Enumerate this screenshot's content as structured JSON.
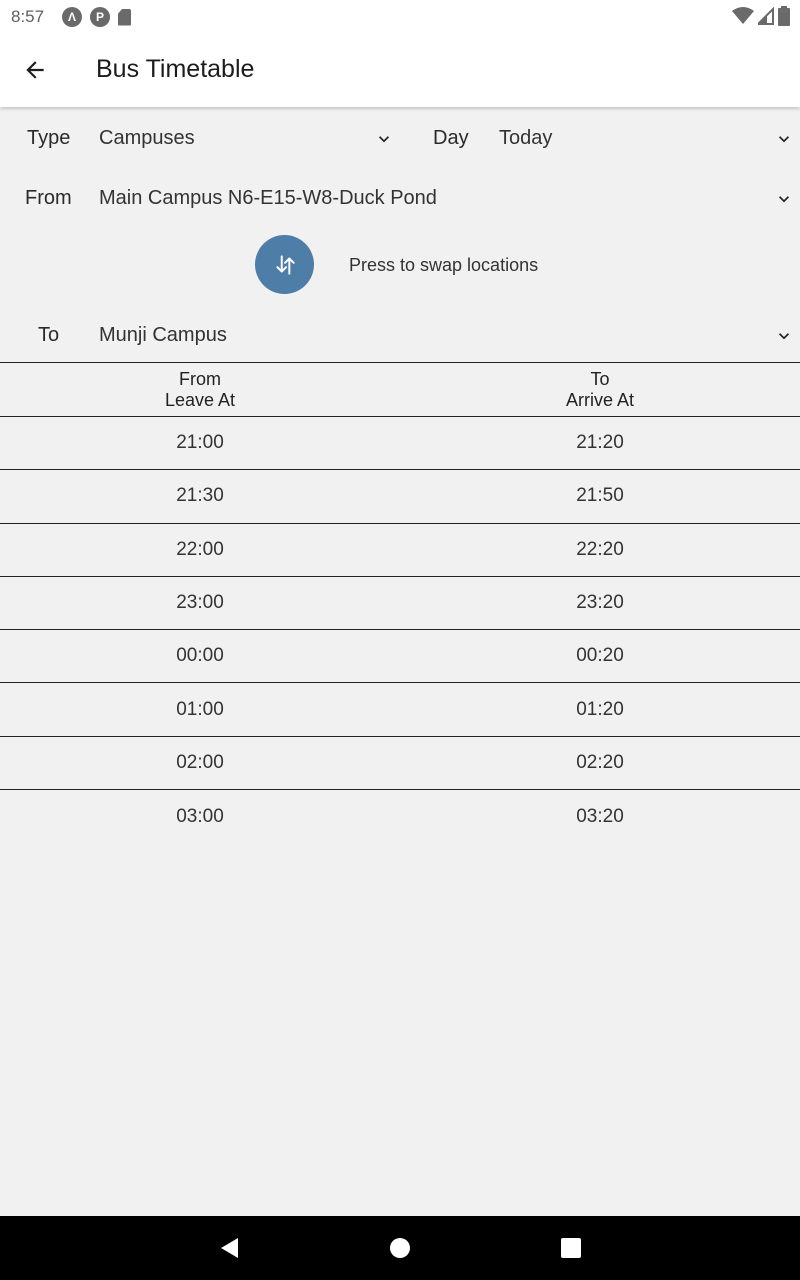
{
  "status_bar": {
    "time": "8:57"
  },
  "app_bar": {
    "title": "Bus Timetable"
  },
  "form": {
    "type_label": "Type",
    "type_value": "Campuses",
    "day_label": "Day",
    "day_value": "Today",
    "from_label": "From",
    "from_value": "Main Campus N6-E15-W8-Duck Pond",
    "swap_hint": "Press to swap locations",
    "to_label": "To",
    "to_value": "Munji Campus"
  },
  "table": {
    "headers": [
      {
        "line1": "From",
        "line2": "Leave At"
      },
      {
        "line1": "To",
        "line2": "Arrive At"
      }
    ],
    "rows": [
      {
        "leave": "21:00",
        "arrive": "21:20"
      },
      {
        "leave": "21:30",
        "arrive": "21:50"
      },
      {
        "leave": "22:00",
        "arrive": "22:20"
      },
      {
        "leave": "23:00",
        "arrive": "23:20"
      },
      {
        "leave": "00:00",
        "arrive": "00:20"
      },
      {
        "leave": "01:00",
        "arrive": "01:20"
      },
      {
        "leave": "02:00",
        "arrive": "02:20"
      },
      {
        "leave": "03:00",
        "arrive": "03:20"
      }
    ]
  },
  "colors": {
    "accent": "#4e7ea8",
    "background": "#f1f1f1"
  },
  "icons": [
    "back-arrow-icon",
    "chevron-down-icon",
    "swap-vertical-icon",
    "wifi-icon",
    "signal-icon",
    "battery-icon"
  ]
}
